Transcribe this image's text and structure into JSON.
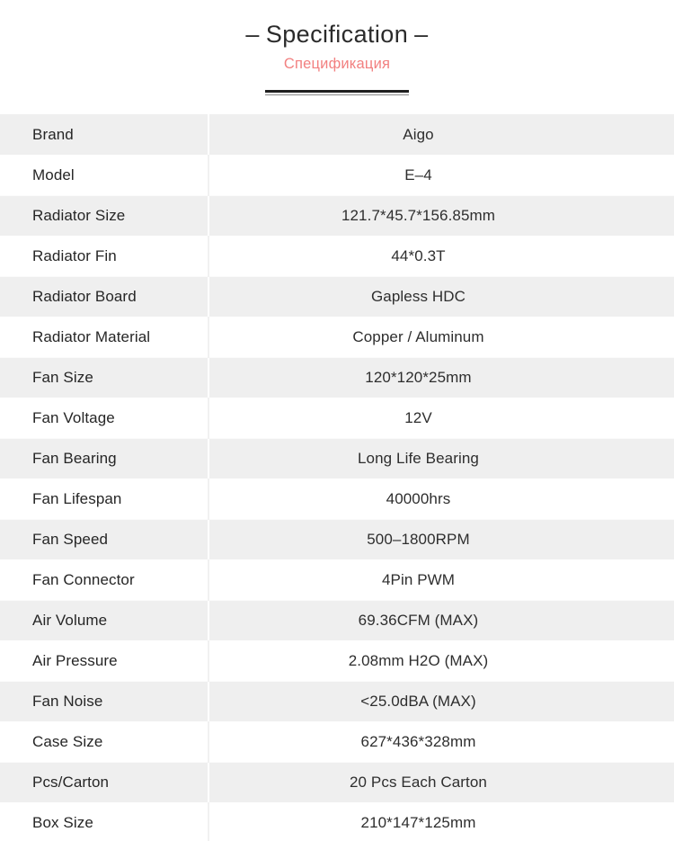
{
  "header": {
    "title_text": "Specification",
    "title_dash_left": "–",
    "title_dash_right": "–",
    "subtitle_text": "Спецификация",
    "subtitle_color": "#f28080",
    "rule_color_primary": "#1f1f1f",
    "rule_color_secondary": "#8a8a8a"
  },
  "table": {
    "row_alt_background": "#efefef",
    "row_plain_background": "#ffffff",
    "rows": [
      {
        "label": "Brand",
        "value": "Aigo"
      },
      {
        "label": "Model",
        "value": "E–4"
      },
      {
        "label": "Radiator Size",
        "value": "121.7*45.7*156.85mm"
      },
      {
        "label": "Radiator Fin",
        "value": "44*0.3T"
      },
      {
        "label": "Radiator Board",
        "value": "Gapless HDC"
      },
      {
        "label": "Radiator Material",
        "value": "Copper / Aluminum"
      },
      {
        "label": "Fan Size",
        "value": "120*120*25mm"
      },
      {
        "label": "Fan Voltage",
        "value": "12V"
      },
      {
        "label": "Fan Bearing",
        "value": "Long Life Bearing"
      },
      {
        "label": "Fan Lifespan",
        "value": "40000hrs"
      },
      {
        "label": "Fan Speed",
        "value": "500–1800RPM"
      },
      {
        "label": "Fan Connector",
        "value": "4Pin PWM"
      },
      {
        "label": "Air Volume",
        "value": "69.36CFM (MAX)"
      },
      {
        "label": "Air Pressure",
        "value": "2.08mm H2O (MAX)"
      },
      {
        "label": "Fan Noise",
        "value": "<25.0dBA (MAX)"
      },
      {
        "label": "Case Size",
        "value": "627*436*328mm"
      },
      {
        "label": "Pcs/Carton",
        "value": "20 Pcs Each Carton"
      },
      {
        "label": "Box Size",
        "value": "210*147*125mm"
      }
    ]
  }
}
